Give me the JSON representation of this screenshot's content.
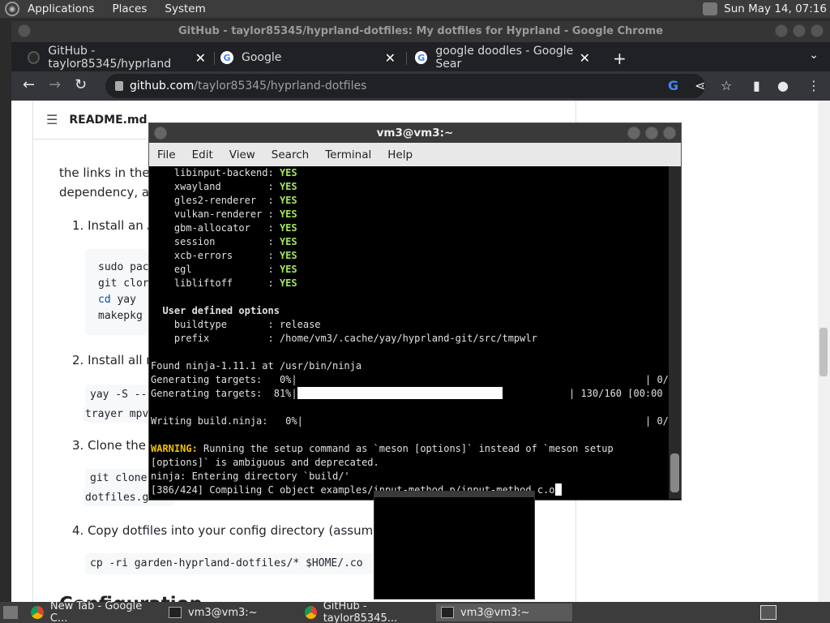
{
  "top_panel": {
    "menus": [
      "Applications",
      "Places",
      "System"
    ],
    "clock": "Sun May 14, 07:16"
  },
  "chrome": {
    "window_title": "GitHub - taylor85345/hyprland-dotfiles: My dotfiles for Hyprland - Google Chrome",
    "tabs": [
      {
        "title": "GitHub - taylor85345/hyprland"
      },
      {
        "title": "Google"
      },
      {
        "title": "google doodles - Google Sear"
      }
    ],
    "url_host": "github.com",
    "url_path": "/taylor85345/hyprland-dotfiles"
  },
  "page": {
    "readme_title": "README.md",
    "intro_line1": "the links in the l",
    "intro_line2": "dependency, an",
    "step1": "1. Install an A",
    "code1": [
      "sudo pac",
      "git clor",
      "cd",
      "yay",
      "makepkg"
    ],
    "step2": "2. Install all re",
    "code2a": "yay -S --",
    "code2b": "trayer mpv",
    "step3": "3. Clone the r",
    "code3a": "git clone",
    "code3b": "dotfiles.g",
    "step4": "4. Copy dotfiles into your config directory (assumptio",
    "code4": "cp -ri garden-hyprland-dotfiles/* $HOME/.co",
    "config_heading": "Configuration"
  },
  "terminal": {
    "title": "vm3@vm3:~",
    "menu": [
      "File",
      "Edit",
      "View",
      "Search",
      "Terminal",
      "Help"
    ],
    "features": [
      {
        "name": "    libinput-backend: ",
        "value": "YES"
      },
      {
        "name": "    xwayland        : ",
        "value": "YES"
      },
      {
        "name": "    gles2-renderer  : ",
        "value": "YES"
      },
      {
        "name": "    vulkan-renderer : ",
        "value": "YES"
      },
      {
        "name": "    gbm-allocator   : ",
        "value": "YES"
      },
      {
        "name": "    session         : ",
        "value": "YES"
      },
      {
        "name": "    xcb-errors      : ",
        "value": "YES"
      },
      {
        "name": "    egl             : ",
        "value": "YES"
      },
      {
        "name": "    libliftoff      : ",
        "value": "YES"
      }
    ],
    "user_opts_header": "  User defined options",
    "buildtype": "    buildtype       : release",
    "prefix": "    prefix          : /home/vm3/.cache/yay/hyprland-git/src/tmpwlr",
    "found_ninja": "Found ninja-1.11.1 at /usr/bin/ninja",
    "gen0": "Generating targets:   0%|",
    "gen0_right": "| 0/",
    "gen81": "Generating targets:  81%|",
    "gen81_right": "| 130/160 [00:00",
    "writing": "Writing build.ninja:   0%|",
    "writing_right": "| 0/",
    "warning_label": "WARNING:",
    "warning_text": " Running the setup command as `meson [options]` instead of `meson setup",
    "warning_text2": "[options]` is ambiguous and deprecated.",
    "ninja_enter": "ninja: Entering directory `build/'",
    "compiling": "[386/424] Compiling C object examples/input-method.p/input-method.c.o",
    "progress_fraction": 0.81
  },
  "taskbar": {
    "items": [
      {
        "label": "New Tab - Google C..."
      },
      {
        "label": "vm3@vm3:~"
      },
      {
        "label": "GitHub - taylor85345..."
      },
      {
        "label": "vm3@vm3:~"
      }
    ]
  }
}
